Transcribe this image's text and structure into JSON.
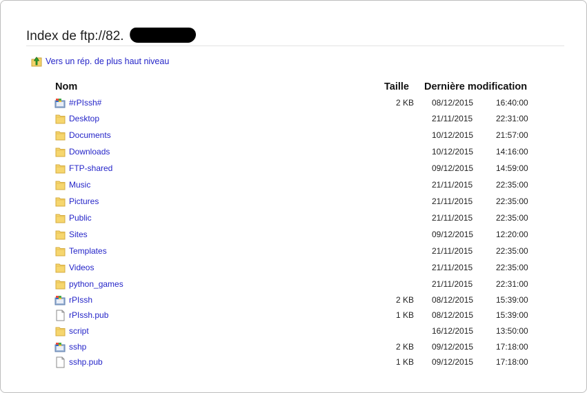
{
  "page": {
    "title": "Index de ftp://82.",
    "up_link_label": "Vers un rép. de plus haut niveau"
  },
  "columns": {
    "name": "Nom",
    "size": "Taille",
    "modified": "Dernière modification"
  },
  "entries": [
    {
      "name": "#rPIssh#",
      "icon": "file-generic-icon",
      "size": "2 KB",
      "date": "08/12/2015",
      "time": "16:40:00"
    },
    {
      "name": "Desktop",
      "icon": "folder-icon",
      "size": "",
      "date": "21/11/2015",
      "time": "22:31:00"
    },
    {
      "name": "Documents",
      "icon": "folder-icon",
      "size": "",
      "date": "10/12/2015",
      "time": "21:57:00"
    },
    {
      "name": "Downloads",
      "icon": "folder-icon",
      "size": "",
      "date": "10/12/2015",
      "time": "14:16:00"
    },
    {
      "name": "FTP-shared",
      "icon": "folder-icon",
      "size": "",
      "date": "09/12/2015",
      "time": "14:59:00"
    },
    {
      "name": "Music",
      "icon": "folder-icon",
      "size": "",
      "date": "21/11/2015",
      "time": "22:35:00"
    },
    {
      "name": "Pictures",
      "icon": "folder-icon",
      "size": "",
      "date": "21/11/2015",
      "time": "22:35:00"
    },
    {
      "name": "Public",
      "icon": "folder-icon",
      "size": "",
      "date": "21/11/2015",
      "time": "22:35:00"
    },
    {
      "name": "Sites",
      "icon": "folder-icon",
      "size": "",
      "date": "09/12/2015",
      "time": "12:20:00"
    },
    {
      "name": "Templates",
      "icon": "folder-icon",
      "size": "",
      "date": "21/11/2015",
      "time": "22:35:00"
    },
    {
      "name": "Videos",
      "icon": "folder-icon",
      "size": "",
      "date": "21/11/2015",
      "time": "22:35:00"
    },
    {
      "name": "python_games",
      "icon": "folder-icon",
      "size": "",
      "date": "21/11/2015",
      "time": "22:31:00"
    },
    {
      "name": "rPIssh",
      "icon": "file-generic-icon",
      "size": "2 KB",
      "date": "08/12/2015",
      "time": "15:39:00"
    },
    {
      "name": "rPIssh.pub",
      "icon": "file-blank-icon",
      "size": "1 KB",
      "date": "08/12/2015",
      "time": "15:39:00"
    },
    {
      "name": "script",
      "icon": "folder-icon",
      "size": "",
      "date": "16/12/2015",
      "time": "13:50:00"
    },
    {
      "name": "sshp",
      "icon": "file-generic-icon",
      "size": "2 KB",
      "date": "09/12/2015",
      "time": "17:18:00"
    },
    {
      "name": "sshp.pub",
      "icon": "file-blank-icon",
      "size": "1 KB",
      "date": "09/12/2015",
      "time": "17:18:00"
    }
  ]
}
